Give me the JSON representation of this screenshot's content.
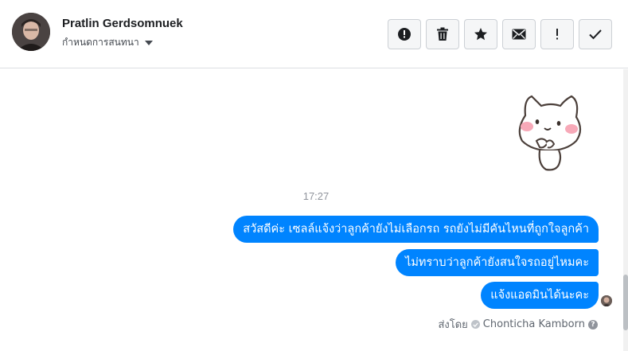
{
  "header": {
    "contact_name": "Pratlin Gerdsomnuek",
    "subtitle": "กำหนดการสนทนา"
  },
  "actions": [
    {
      "icon": "alert-circle-icon",
      "label": "!"
    },
    {
      "icon": "trash-icon",
      "label": ""
    },
    {
      "icon": "star-icon",
      "label": ""
    },
    {
      "icon": "envelope-icon",
      "label": ""
    },
    {
      "icon": "exclamation-icon",
      "label": "!"
    },
    {
      "icon": "check-icon",
      "label": ""
    }
  ],
  "conversation": {
    "time": "17:27",
    "messages": [
      {
        "text": "สวัสดีค่ะ เซลล์แจ้งว่าลูกค้ายังไม่เลือกรถ รถยังไม่มีคันไหนที่ถูกใจลูกค้า"
      },
      {
        "text": "ไม่ทราบว่าลูกค้ายังสนใจรถอยู่ไหมคะ"
      },
      {
        "text": "แจ้งแอดมินได้นะคะ"
      }
    ],
    "sent_by_label": "ส่งโดย",
    "sent_by_name": "Chonticha Kamborn",
    "help_glyph": "?"
  },
  "colors": {
    "bubble": "#0084ff",
    "button_bg": "#f5f6f7"
  }
}
